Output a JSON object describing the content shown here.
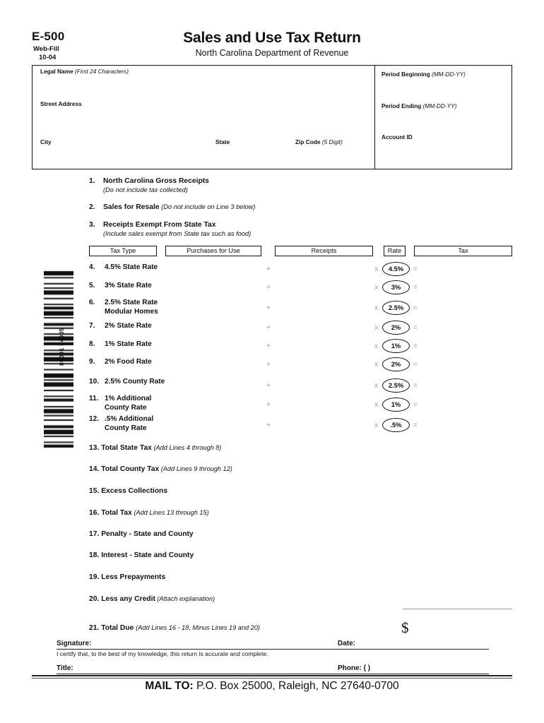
{
  "header": {
    "form_number": "E-500",
    "web_fill": "Web-Fill",
    "revision_date": "10-04",
    "title": "Sales and Use Tax Return",
    "subtitle": "North Carolina Department of Revenue"
  },
  "taxpayer_box": {
    "legal_name_label": "Legal Name",
    "legal_name_hint": "(First 24 Characters)",
    "street_label": "Street Address",
    "city_label": "City",
    "state_label": "State",
    "zip_label": "Zip Code",
    "zip_hint": "(5 Digit)",
    "period_beginning_label": "Period Beginning",
    "period_beginning_hint": "(MM-DD-YY)",
    "period_ending_label": "Period Ending",
    "period_ending_hint": "(MM-DD-YY)",
    "account_id_label": "Account ID"
  },
  "barcode": {
    "number": "80001 04005"
  },
  "intro_lines": [
    {
      "num": "1.",
      "label": "North Carolina Gross Receipts",
      "sub": "(Do not include tax collected)"
    },
    {
      "num": "2.",
      "label": "Sales for Resale",
      "paren": "(Do not include on Line 3 below)",
      "sub": ""
    },
    {
      "num": "3.",
      "label": "Receipts Exempt From State Tax",
      "sub": "(Include sales exempt from State tax such as food)"
    }
  ],
  "table_headers": {
    "tax_type": "Tax Type",
    "purchases_for_use": "Purchases for Use",
    "receipts": "Receipts",
    "rate": "Rate",
    "tax": "Tax"
  },
  "operators": {
    "plus": "+",
    "times": "x",
    "equals": "="
  },
  "rate_rows": [
    {
      "num": "4.",
      "label_line1": "4.5% State Rate",
      "label_line2": "",
      "rate": "4.5%"
    },
    {
      "num": "5.",
      "label_line1": "3% State Rate",
      "label_line2": "",
      "rate": "3%"
    },
    {
      "num": "6.",
      "label_line1": "2.5% State Rate",
      "label_line2": "Modular Homes",
      "rate": "2.5%"
    },
    {
      "num": "7.",
      "label_line1": "2% State Rate",
      "label_line2": "",
      "rate": "2%"
    },
    {
      "num": "8.",
      "label_line1": "1% State Rate",
      "label_line2": "",
      "rate": "1%"
    },
    {
      "num": "9.",
      "label_line1": "2% Food Rate",
      "label_line2": "",
      "rate": "2%"
    },
    {
      "num": "10.",
      "label_line1": "2.5% County Rate",
      "label_line2": "",
      "rate": "2.5%"
    },
    {
      "num": "11.",
      "label_line1": "1% Additional",
      "label_line2": "County Rate",
      "rate": "1%"
    },
    {
      "num": "12.",
      "label_line1": ".5% Additional",
      "label_line2": "County Rate",
      "rate": ".5%"
    }
  ],
  "total_rows": [
    {
      "num": "13.",
      "label": "Total State Tax",
      "paren": "(Add Lines 4 through 8)"
    },
    {
      "num": "14.",
      "label": "Total County Tax",
      "paren": "(Add Lines 9 through 12)"
    },
    {
      "num": "15.",
      "label": "Excess Collections",
      "paren": ""
    },
    {
      "num": "16.",
      "label": "Total Tax",
      "paren": "(Add Lines 13 through 15)"
    },
    {
      "num": "17.",
      "label": "Penalty - State and County",
      "paren": ""
    },
    {
      "num": "18.",
      "label": "Interest - State and County",
      "paren": ""
    },
    {
      "num": "19.",
      "label": "Less Prepayments",
      "paren": ""
    },
    {
      "num": "20.",
      "label": "Less any Credit",
      "paren": "(Attach  explanation)"
    }
  ],
  "total_due": {
    "num": "21.",
    "label": "Total Due",
    "paren": "(Add Lines 16 - 18, Minus Lines 19 and 20)",
    "currency_symbol": "$"
  },
  "signature_block": {
    "signature_label": "Signature:",
    "date_label": "Date:",
    "certification": "I certify that, to the best of my knowledge, this return is accurate and complete.",
    "title_label": "Title:",
    "phone_label": "Phone: (            )"
  },
  "footer": {
    "mail_to_label": "MAIL TO:",
    "mail_to_address": " P.O. Box 25000, Raleigh, NC 27640-0700"
  }
}
